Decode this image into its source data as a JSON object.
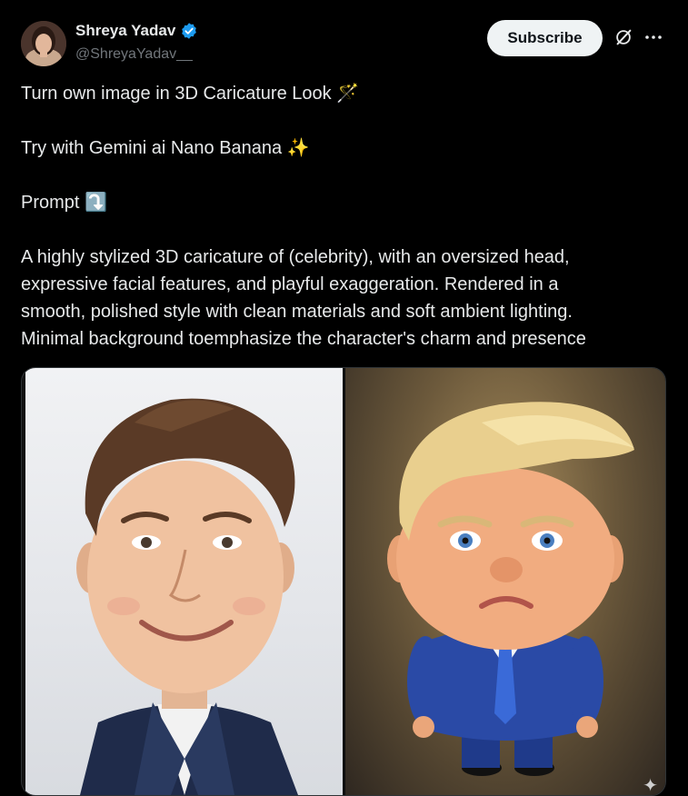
{
  "author": {
    "display_name": "Shreya Yadav",
    "handle": "@ShreyaYadav__"
  },
  "header": {
    "subscribe_label": "Subscribe",
    "grok_icon": "grok-icon",
    "more_icon": "more-icon"
  },
  "tweet": {
    "line1": "Turn own image in 3D Caricature Look 🪄",
    "line2": "Try with Gemini ai Nano Banana ✨",
    "line3": "Prompt ⤵️",
    "body": [
      "A highly stylized 3D caricature of (celebrity), with an oversized head,",
      "expressive facial features, and playful exaggeration. Rendered in a",
      "smooth, polished style with clean materials and soft ambient lighting.",
      "Minimal background toemphasize the character's charm and presence"
    ]
  },
  "media": {
    "sparkle": "✦"
  },
  "colors": {
    "background": "#000000",
    "text": "#e7e9ea",
    "muted": "#71767b",
    "verified": "#1d9bf0",
    "subscribe_bg": "#eff3f4"
  }
}
